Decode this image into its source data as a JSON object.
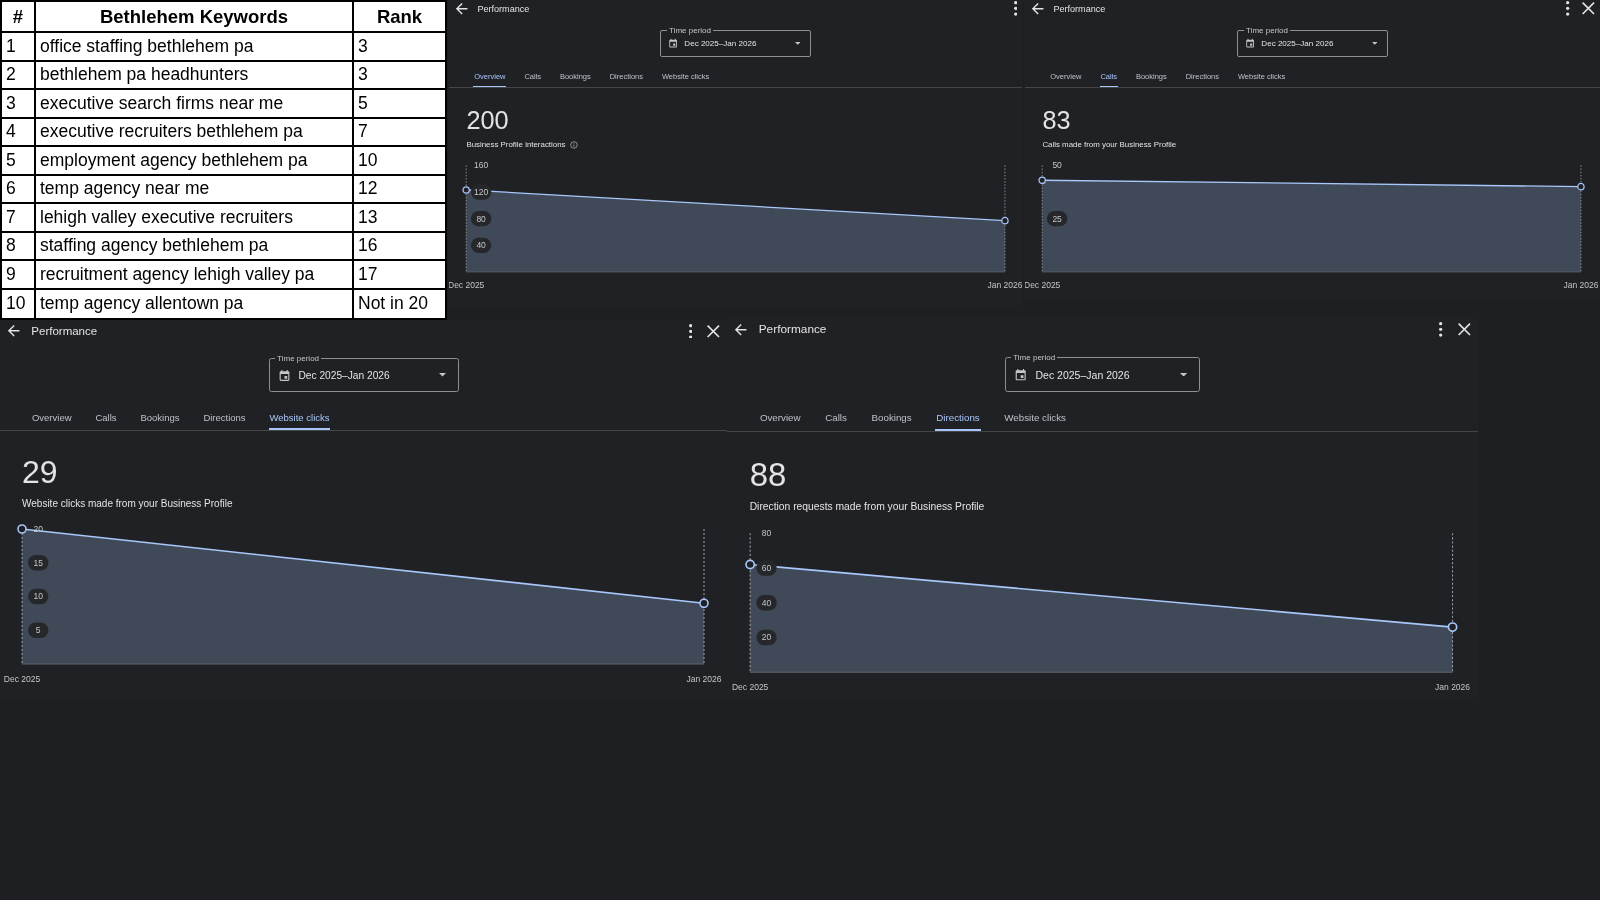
{
  "keywords_table": {
    "columns": [
      "#",
      "Bethlehem Keywords",
      "Rank"
    ],
    "rows": [
      [
        "1",
        "office staffing bethlehem pa",
        "3"
      ],
      [
        "2",
        "bethlehem pa headhunters",
        "3"
      ],
      [
        "3",
        "executive search firms near me",
        "5"
      ],
      [
        "4",
        "executive recruiters bethlehem pa",
        "7"
      ],
      [
        "5",
        "employment agency bethlehem pa",
        "10"
      ],
      [
        "6",
        "temp agency near me",
        "12"
      ],
      [
        "7",
        "lehigh valley executive recruiters",
        "13"
      ],
      [
        "8",
        "staffing agency bethlehem pa",
        "16"
      ],
      [
        "9",
        "recruitment agency lehigh valley pa",
        "17"
      ],
      [
        "10",
        "temp agency allentown pa",
        "Not in 20"
      ]
    ]
  },
  "panels": [
    {
      "title": "Performance",
      "close_button": false,
      "time_period": {
        "label": "Time period",
        "value": "Dec 2025–Jan 2026"
      },
      "tabs": [
        {
          "label": "Overview",
          "selected": true
        },
        {
          "label": "Calls",
          "selected": false
        },
        {
          "label": "Bookings",
          "selected": false
        },
        {
          "label": "Directions",
          "selected": false
        },
        {
          "label": "Website clicks",
          "selected": false
        }
      ],
      "total": "200",
      "description": "Business Profile interactions",
      "info_icon": true,
      "chart_data": {
        "type": "area",
        "categories": [
          "Dec 2025",
          "Jan 2026"
        ],
        "yticks": [
          40,
          80,
          120,
          160
        ],
        "ylim": [
          0,
          160
        ],
        "series": [
          {
            "color": "#a8c7fa",
            "values": [
              123,
              77
            ]
          }
        ]
      }
    },
    {
      "title": "Performance",
      "close_button": true,
      "time_period": {
        "label": "Time period",
        "value": "Dec 2025–Jan 2026"
      },
      "tabs": [
        {
          "label": "Overview",
          "selected": false
        },
        {
          "label": "Calls",
          "selected": true
        },
        {
          "label": "Bookings",
          "selected": false
        },
        {
          "label": "Directions",
          "selected": false
        },
        {
          "label": "Website clicks",
          "selected": false
        }
      ],
      "total": "83",
      "description": "Calls made from your Business Profile",
      "info_icon": false,
      "chart_data": {
        "type": "area",
        "categories": [
          "Dec 2025",
          "Jan 2026"
        ],
        "yticks": [
          25,
          50
        ],
        "ylim": [
          0,
          50
        ],
        "series": [
          {
            "color": "#a8c7fa",
            "values": [
              43,
              40
            ]
          }
        ]
      }
    },
    {
      "title": "Performance",
      "close_button": true,
      "time_period": {
        "label": "Time period",
        "value": "Dec 2025–Jan 2026"
      },
      "tabs": [
        {
          "label": "Overview",
          "selected": false
        },
        {
          "label": "Calls",
          "selected": false
        },
        {
          "label": "Bookings",
          "selected": false
        },
        {
          "label": "Directions",
          "selected": false
        },
        {
          "label": "Website clicks",
          "selected": true
        }
      ],
      "total": "29",
      "description": "Website clicks made from your Business Profile",
      "info_icon": false,
      "chart_data": {
        "type": "area",
        "categories": [
          "Dec 2025",
          "Jan 2026"
        ],
        "yticks": [
          5,
          10,
          15,
          20
        ],
        "ylim": [
          0,
          20
        ],
        "series": [
          {
            "color": "#a8c7fa",
            "values": [
              20,
              9
            ]
          }
        ]
      }
    },
    {
      "title": "Performance",
      "close_button": true,
      "time_period": {
        "label": "Time period",
        "value": "Dec 2025–Jan 2026"
      },
      "tabs": [
        {
          "label": "Overview",
          "selected": false
        },
        {
          "label": "Calls",
          "selected": false
        },
        {
          "label": "Bookings",
          "selected": false
        },
        {
          "label": "Directions",
          "selected": true
        },
        {
          "label": "Website clicks",
          "selected": false
        }
      ],
      "total": "88",
      "description": "Direction requests made from your Business Profile",
      "info_icon": false,
      "chart_data": {
        "type": "area",
        "categories": [
          "Dec 2025",
          "Jan 2026"
        ],
        "yticks": [
          20,
          40,
          60,
          80
        ],
        "ylim": [
          0,
          80
        ],
        "series": [
          {
            "color": "#a8c7fa",
            "values": [
              62,
              26
            ]
          }
        ]
      }
    }
  ]
}
